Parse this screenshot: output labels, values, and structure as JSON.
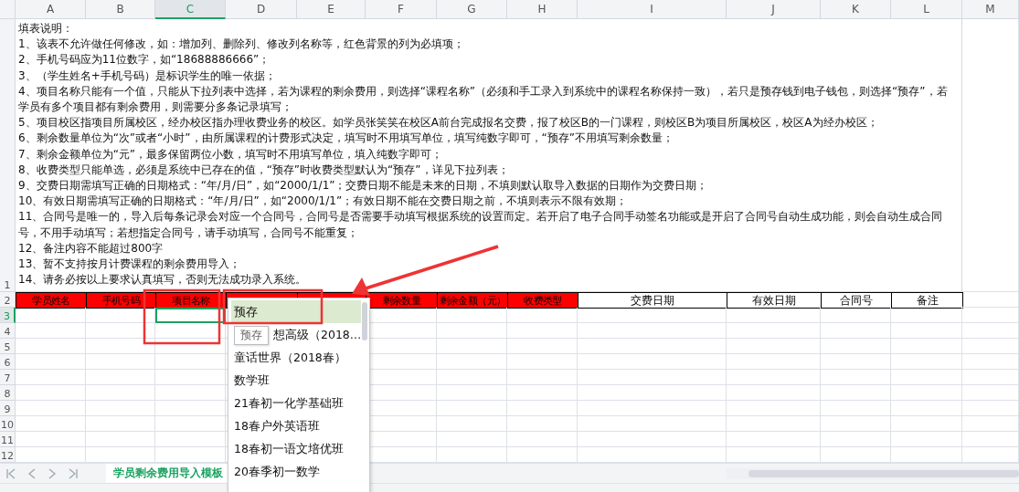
{
  "column_letters": [
    {
      "label": "A",
      "selected": false
    },
    {
      "label": "B",
      "selected": false
    },
    {
      "label": "C",
      "selected": true
    },
    {
      "label": "D",
      "selected": false
    },
    {
      "label": "E",
      "selected": false
    },
    {
      "label": "F",
      "selected": false
    },
    {
      "label": "G",
      "selected": false
    },
    {
      "label": "H",
      "selected": false
    },
    {
      "label": "I",
      "selected": false
    },
    {
      "label": "J",
      "selected": false
    },
    {
      "label": "K",
      "selected": false
    },
    {
      "label": "L",
      "selected": false
    },
    {
      "label": "M",
      "selected": false
    }
  ],
  "row_numbers": [
    {
      "label": "1",
      "selected": false
    },
    {
      "label": "2",
      "selected": false
    },
    {
      "label": "3",
      "selected": true
    },
    {
      "label": "4",
      "selected": false
    },
    {
      "label": "5",
      "selected": false
    },
    {
      "label": "6",
      "selected": false
    },
    {
      "label": "7",
      "selected": false
    },
    {
      "label": "8",
      "selected": false
    },
    {
      "label": "9",
      "selected": false
    },
    {
      "label": "10",
      "selected": false
    },
    {
      "label": "11",
      "selected": false
    },
    {
      "label": "12",
      "selected": false
    }
  ],
  "instructions": {
    "title": "填表说明：",
    "items": [
      "1、该表不允许做任何修改，如：增加列、删除列、修改列名称等，红色背景的列为必填项；",
      "2、手机号码应为11位数字，如“18688886666”；",
      "3、（学生姓名+手机号码）是标识学生的唯一依据；",
      "4、项目名称只能有一个值，只能从下拉列表中选择，若为课程的剩余费用，则选择“课程名称”（必须和手工录入到系统中的课程名称保持一致），若只是预存钱到电子钱包，则选择“预存”，若学员有多个项目都有剩余费用，则需要分多条记录填写；",
      "5、项目校区指项目所属校区，经办校区指办理收费业务的校区。如学员张笑笑在校区A前台完成报名交费，报了校区B的一门课程，则校区B为项目所属校区，校区A为经办校区；",
      "6、剩余数量单位为“次”或者“小时”，由所属课程的计费形式决定，填写时不用填写单位，填写纯数字即可，“预存”不用填写剩余数量；",
      "7、剩余金额单位为“元”，最多保留两位小数，填写时不用填写单位，填入纯数字即可；",
      "8、收费类型只能单选，必须是系统中已存在的值，“预存”时收费类型默认为“预存”，详见下拉列表；",
      "9、交费日期需填写正确的日期格式：“年/月/日”，如“2000/1/1”；交费日期不能是未来的日期，不填则默认取导入数据的日期作为交费日期；",
      "10、有效日期需填写正确的日期格式：“年/月/日”，如“2000/1/1”；有效日期不能在交费日期之前，不填则表示不限有效期；",
      "11、合同号是唯一的，导入后每条记录会对应一个合同号，合同号是否需要手动填写根据系统的设置而定。若开启了电子合同手动签名功能或是开启了合同号自动生成功能，则会自动生成合同号，不用手动填写；若想指定合同号，请手动填写，合同号不能重复；",
      "12、备注内容不能超过800字",
      "13、暂不支持按月计费课程的剩余费用导入；",
      "14、请务必按以上要求认真填写，否则无法成功录入系统。"
    ]
  },
  "header_row": [
    {
      "label": "学员姓名",
      "required": true
    },
    {
      "label": "手机号码",
      "required": true
    },
    {
      "label": "项目名称",
      "required": true
    },
    {
      "required": true
    },
    {
      "required": true
    },
    {
      "label": "剩余数量",
      "required": true
    },
    {
      "label": "剩余金额（元）",
      "required": true
    },
    {
      "label": "收费类型",
      "required": true
    },
    {
      "label": "交费日期",
      "required": false
    },
    {
      "label": "有效日期",
      "required": false
    },
    {
      "label": "合同号",
      "required": false
    },
    {
      "label": "备注",
      "required": false
    }
  ],
  "dropdown": {
    "tooltip": "预存",
    "items": [
      {
        "label": "预存",
        "selected": true
      },
      {
        "label": "想高级（2018…",
        "selected": false
      },
      {
        "label": "童话世界（2018春）",
        "selected": false
      },
      {
        "label": "数学班",
        "selected": false
      },
      {
        "label": "21春初一化学基础班",
        "selected": false
      },
      {
        "label": "18春户外英语班",
        "selected": false
      },
      {
        "label": "18春初一语文培优班",
        "selected": false
      },
      {
        "label": "20春季初一数学",
        "selected": false
      }
    ]
  },
  "sheet_tabs": [
    {
      "label": "学员剩余费用导入模板",
      "selected": true
    }
  ]
}
